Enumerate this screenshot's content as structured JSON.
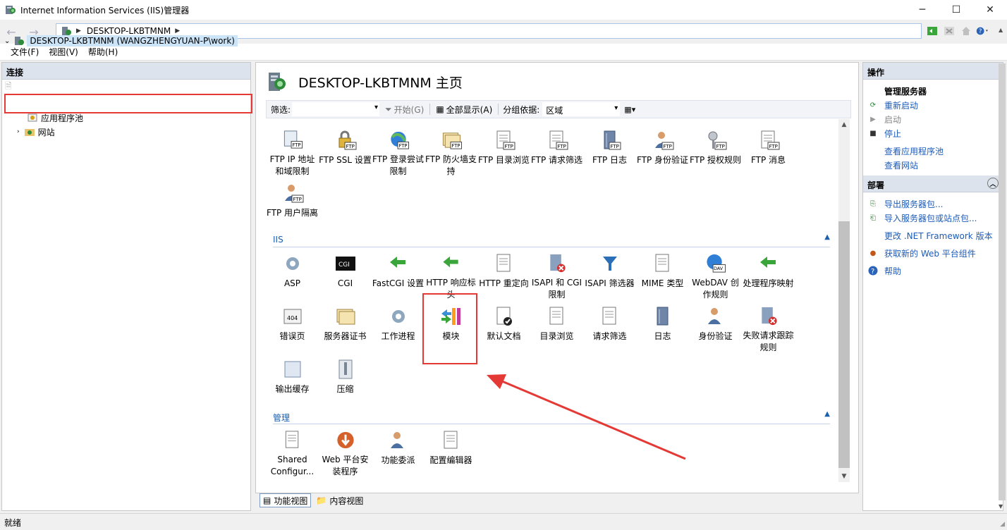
{
  "window": {
    "title": "Internet Information Services (IIS)管理器",
    "minimize": "─",
    "maximize": "☐",
    "close": "✕"
  },
  "address": {
    "crumb": "DESKTOP-LKBTMNM"
  },
  "menu": [
    "文件(F)",
    "视图(V)",
    "帮助(H)"
  ],
  "left": {
    "header": "连接",
    "tree": {
      "root": "DESKTOP-LKBTMNM (WANGZHENGYUAN-P\\work)",
      "children": [
        "应用程序池",
        "网站"
      ]
    }
  },
  "center": {
    "title": "DESKTOP-LKBTMNM 主页",
    "filter": {
      "label": "筛选:",
      "start": "开始(G)",
      "show_all": "全部显示(A)",
      "group_label": "分组依据:",
      "group_value": "区域"
    },
    "ftp_items": [
      {
        "label": "FTP IP 地址和域限制",
        "icon": "ftp-ip-icon"
      },
      {
        "label": "FTP SSL 设置",
        "icon": "ftp-ssl-icon"
      },
      {
        "label": "FTP 登录尝试限制",
        "icon": "ftp-login-icon"
      },
      {
        "label": "FTP 防火墙支持",
        "icon": "ftp-firewall-icon"
      },
      {
        "label": "FTP 目录浏览",
        "icon": "ftp-dir-icon"
      },
      {
        "label": "FTP 请求筛选",
        "icon": "ftp-filter-icon"
      },
      {
        "label": "FTP 日志",
        "icon": "ftp-log-icon"
      },
      {
        "label": "FTP 身份验证",
        "icon": "ftp-auth-icon"
      },
      {
        "label": "FTP 授权规则",
        "icon": "ftp-authz-icon"
      },
      {
        "label": "FTP 消息",
        "icon": "ftp-msg-icon"
      },
      {
        "label": "FTP 用户隔离",
        "icon": "ftp-isolation-icon"
      }
    ],
    "iis_section": "IIS",
    "iis_items": [
      {
        "label": "ASP",
        "icon": "asp-icon"
      },
      {
        "label": "CGI",
        "icon": "cgi-icon"
      },
      {
        "label": "FastCGI 设置",
        "icon": "fastcgi-icon"
      },
      {
        "label": "HTTP 响应标头",
        "icon": "http-headers-icon"
      },
      {
        "label": "HTTP 重定向",
        "icon": "http-redirect-icon"
      },
      {
        "label": "ISAPI 和 CGI 限制",
        "icon": "isapi-cgi-icon"
      },
      {
        "label": "ISAPI 筛选器",
        "icon": "isapi-filter-icon"
      },
      {
        "label": "MIME 类型",
        "icon": "mime-icon"
      },
      {
        "label": "WebDAV 创作规则",
        "icon": "webdav-icon"
      },
      {
        "label": "处理程序映射",
        "icon": "handler-icon"
      },
      {
        "label": "错误页",
        "icon": "error-page-icon"
      },
      {
        "label": "服务器证书",
        "icon": "certificate-icon"
      },
      {
        "label": "工作进程",
        "icon": "worker-process-icon"
      },
      {
        "label": "模块",
        "icon": "modules-icon"
      },
      {
        "label": "默认文档",
        "icon": "default-doc-icon"
      },
      {
        "label": "目录浏览",
        "icon": "dir-browse-icon"
      },
      {
        "label": "请求筛选",
        "icon": "request-filter-icon"
      },
      {
        "label": "日志",
        "icon": "log-icon"
      },
      {
        "label": "身份验证",
        "icon": "auth-icon"
      },
      {
        "label": "失败请求跟踪规则",
        "icon": "failed-request-icon"
      },
      {
        "label": "输出缓存",
        "icon": "output-cache-icon"
      },
      {
        "label": "压缩",
        "icon": "compression-icon"
      }
    ],
    "mgmt_section": "管理",
    "mgmt_items": [
      {
        "label": "Shared Configur...",
        "icon": "shared-config-icon"
      },
      {
        "label": "Web 平台安装程序",
        "icon": "web-platform-icon"
      },
      {
        "label": "功能委派",
        "icon": "feature-delegation-icon"
      },
      {
        "label": "配置编辑器",
        "icon": "config-editor-icon"
      }
    ],
    "tabs": [
      "功能视图",
      "内容视图"
    ]
  },
  "right": {
    "header": "操作",
    "manage_server": "管理服务器",
    "actions_top": [
      {
        "label": "重新启动",
        "icon": "restart-icon",
        "enabled": true
      },
      {
        "label": "启动",
        "icon": "start-icon",
        "enabled": false
      },
      {
        "label": "停止",
        "icon": "stop-icon",
        "enabled": true
      }
    ],
    "actions_view": [
      "查看应用程序池",
      "查看网站"
    ],
    "deploy_header": "部署",
    "deploy_actions": [
      {
        "label": "导出服务器包...",
        "icon": "export-icon"
      },
      {
        "label": "导入服务器包或站点包...",
        "icon": "import-icon"
      },
      {
        "label": "更改 .NET Framework 版本",
        "icon": ""
      },
      {
        "label": "获取新的 Web 平台组件",
        "icon": "web-platform-small-icon"
      },
      {
        "label": "帮助",
        "icon": "help-icon"
      }
    ]
  },
  "status": "就绪",
  "colors": {
    "accent": "#1c5bb8",
    "highlight": "#e53935",
    "header_bg": "#dde3ec"
  }
}
